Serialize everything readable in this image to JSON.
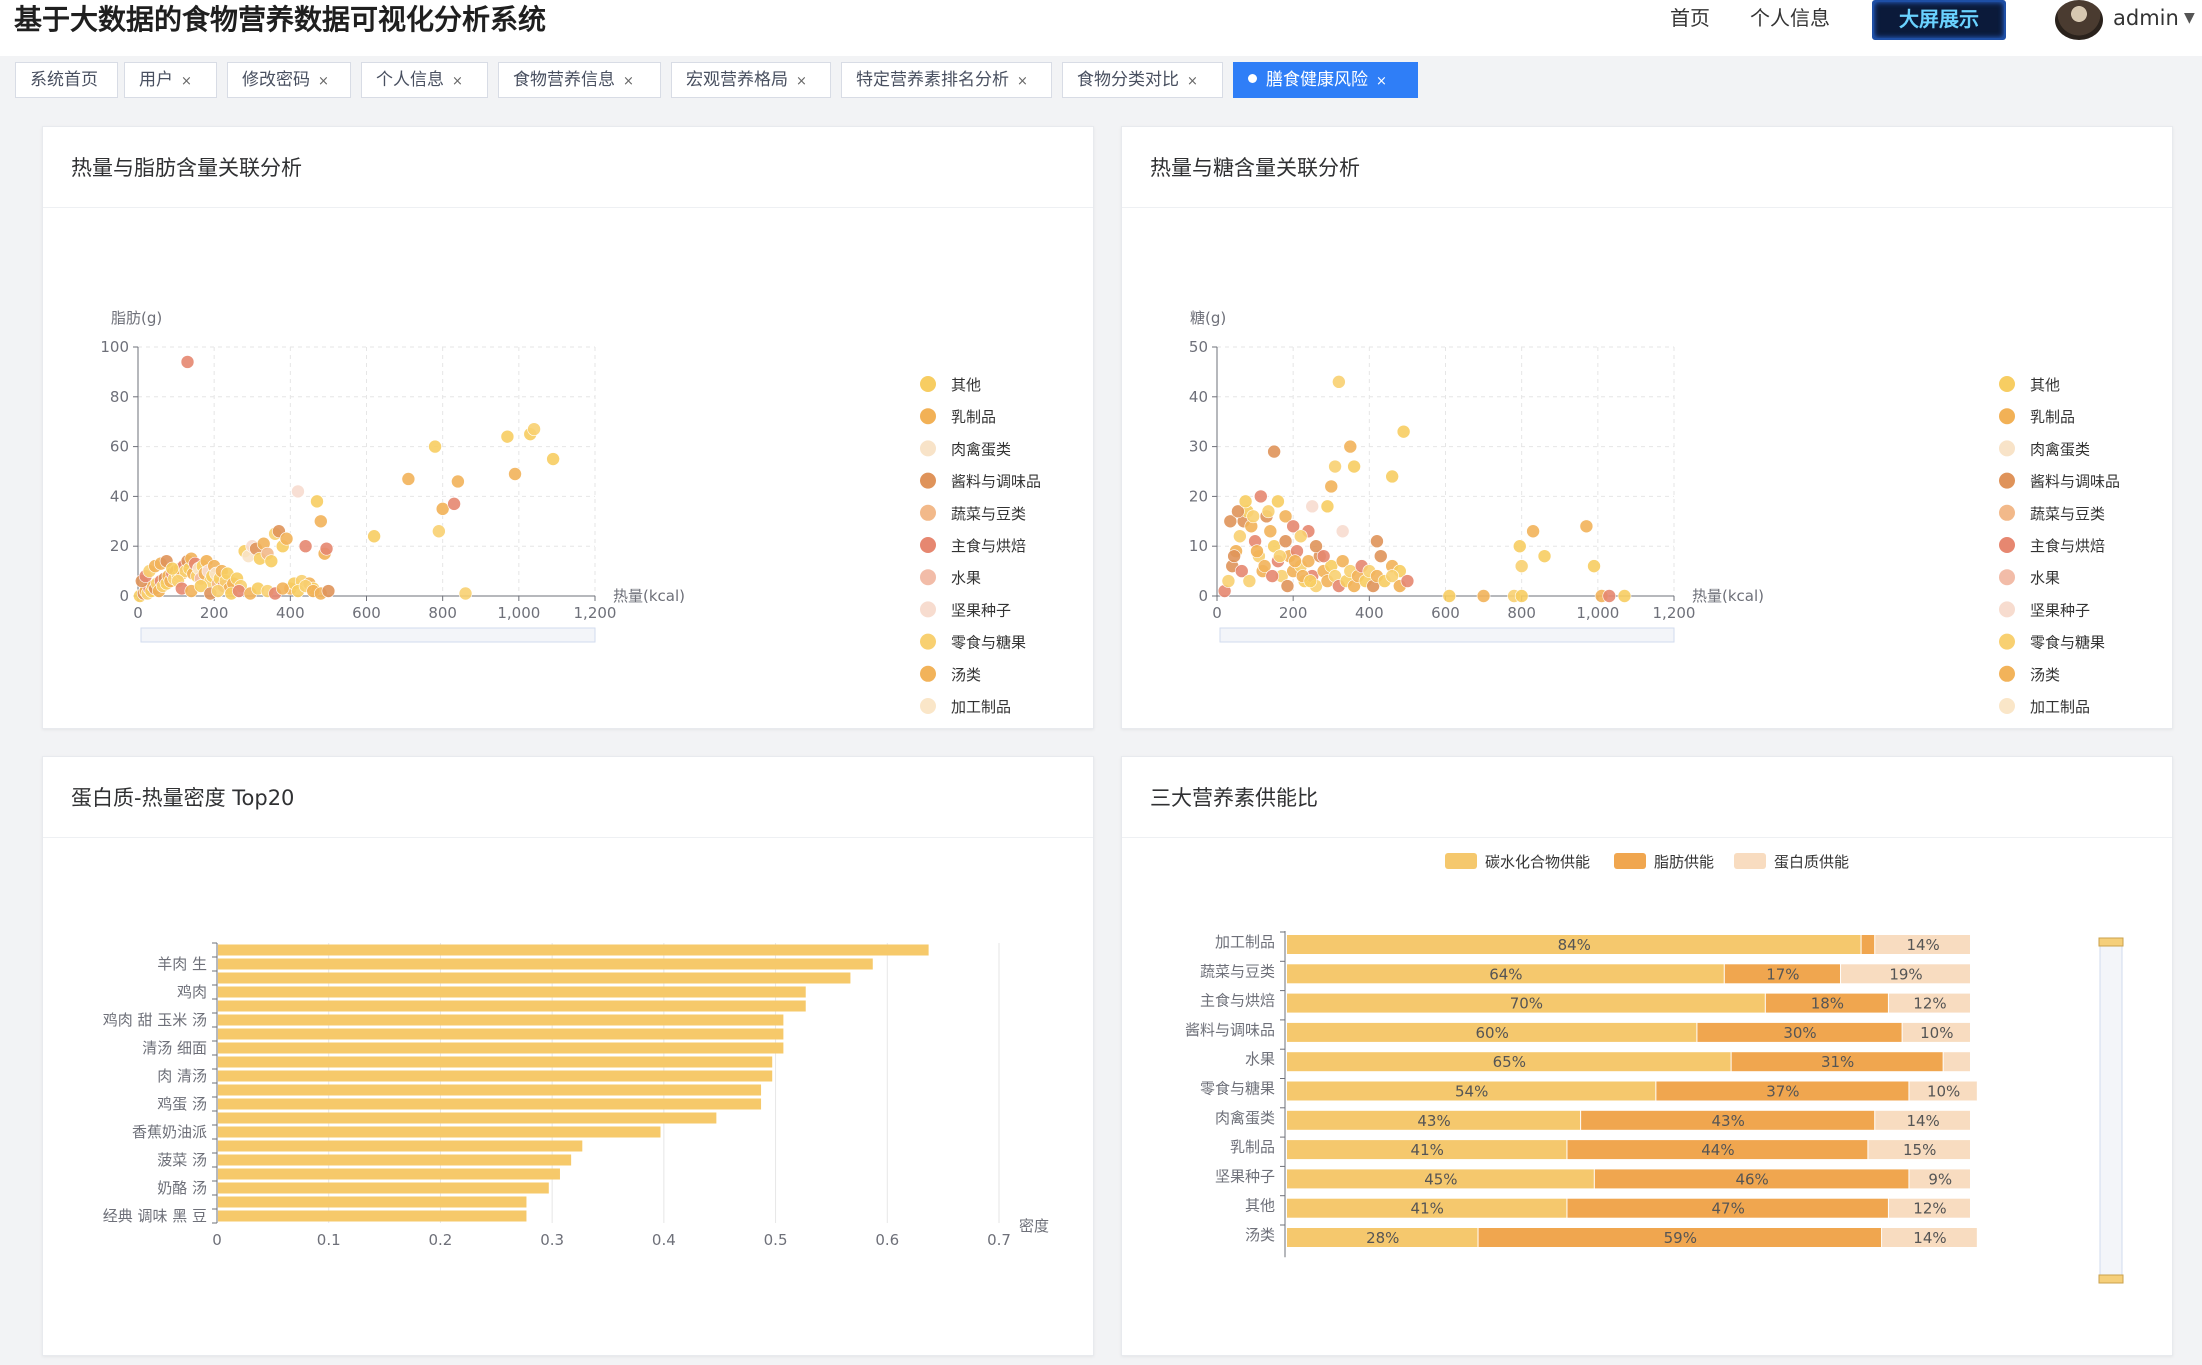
{
  "app": {
    "title": "基于大数据的食物营养数据可视化分析系统"
  },
  "nav": {
    "home": "首页",
    "profile": "个人信息",
    "big_screen": "大屏展示",
    "user": "admin"
  },
  "tabs": [
    {
      "label": "系统首页",
      "closable": false,
      "active": false
    },
    {
      "label": "用户",
      "closable": true,
      "active": false
    },
    {
      "label": "修改密码",
      "closable": true,
      "active": false
    },
    {
      "label": "个人信息",
      "closable": true,
      "active": false
    },
    {
      "label": "食物营养信息",
      "closable": true,
      "active": false
    },
    {
      "label": "宏观营养格局",
      "closable": true,
      "active": false
    },
    {
      "label": "特定营养素排名分析",
      "closable": true,
      "active": false
    },
    {
      "label": "食物分类对比",
      "closable": true,
      "active": false
    },
    {
      "label": "膳食健康风险",
      "closable": true,
      "active": true
    }
  ],
  "colors": {
    "accent": "#2f7ef7",
    "bar": "#f6c96a",
    "carb": "#f5c86d",
    "fat": "#f0a64f",
    "protein": "#f8dcc0"
  },
  "categories": [
    {
      "name": "其他",
      "color": "#f7cd62"
    },
    {
      "name": "乳制品",
      "color": "#f2b156"
    },
    {
      "name": "肉禽蛋类",
      "color": "#f8e3c8"
    },
    {
      "name": "酱料与调味品",
      "color": "#df935a"
    },
    {
      "name": "蔬菜与豆类",
      "color": "#f2b98a"
    },
    {
      "name": "主食与烘焙",
      "color": "#e68770"
    },
    {
      "name": "水果",
      "color": "#f2bca8"
    },
    {
      "name": "坚果种子",
      "color": "#f7dccf"
    },
    {
      "name": "零食与糖果",
      "color": "#f8d071"
    },
    {
      "name": "汤类",
      "color": "#f2b35a"
    },
    {
      "name": "加工制品",
      "color": "#fae6c8"
    }
  ],
  "panels": {
    "fat_scatter": {
      "title": "热量与脂肪含量关联分析"
    },
    "sugar_scatter": {
      "title": "热量与糖含量关联分析"
    },
    "protein_bar": {
      "title": "蛋白质-热量密度 Top20"
    },
    "macro_stack": {
      "title": "三大营养素供能比"
    }
  },
  "chart_data": [
    {
      "id": "fat_scatter",
      "type": "scatter",
      "xlabel": "热量(kcal)",
      "ylabel": "脂肪(g)",
      "xlim": [
        0,
        1200
      ],
      "ylim": [
        0,
        100
      ],
      "xticks": [
        0,
        200,
        400,
        600,
        800,
        1000,
        1200
      ],
      "xtick_labels": [
        "0",
        "200",
        "400",
        "600",
        "800",
        "1,000",
        "1,200"
      ],
      "yticks": [
        0,
        20,
        40,
        60,
        80,
        100
      ],
      "grid": true,
      "legend_position": "right",
      "points": [
        [
          130,
          94,
          5
        ],
        [
          5,
          0,
          0
        ],
        [
          15,
          1,
          3
        ],
        [
          20,
          2,
          1
        ],
        [
          25,
          1,
          8
        ],
        [
          30,
          3,
          5
        ],
        [
          35,
          2,
          0
        ],
        [
          40,
          4,
          9
        ],
        [
          45,
          3,
          3
        ],
        [
          50,
          5,
          8
        ],
        [
          55,
          2,
          1
        ],
        [
          60,
          6,
          5
        ],
        [
          65,
          4,
          8
        ],
        [
          70,
          7,
          3
        ],
        [
          75,
          5,
          0
        ],
        [
          80,
          8,
          9
        ],
        [
          85,
          6,
          1
        ],
        [
          90,
          9,
          5
        ],
        [
          95,
          7,
          8
        ],
        [
          100,
          10,
          3
        ],
        [
          105,
          8,
          0
        ],
        [
          110,
          11,
          9
        ],
        [
          115,
          9,
          1
        ],
        [
          120,
          12,
          5
        ],
        [
          125,
          10,
          8
        ],
        [
          130,
          14,
          3
        ],
        [
          135,
          11,
          0
        ],
        [
          140,
          15,
          9
        ],
        [
          145,
          9,
          1
        ],
        [
          150,
          13,
          5
        ],
        [
          155,
          8,
          8
        ],
        [
          160,
          11,
          10
        ],
        [
          165,
          7,
          6
        ],
        [
          170,
          12,
          0
        ],
        [
          175,
          9,
          9
        ],
        [
          180,
          14,
          1
        ],
        [
          185,
          10,
          7
        ],
        [
          190,
          6,
          8
        ],
        [
          195,
          8,
          0
        ],
        [
          200,
          12,
          9
        ],
        [
          205,
          9,
          2
        ],
        [
          210,
          5,
          4
        ],
        [
          215,
          7,
          0
        ],
        [
          220,
          10,
          9
        ],
        [
          225,
          4,
          5
        ],
        [
          230,
          6,
          8
        ],
        [
          235,
          9,
          0
        ],
        [
          240,
          3,
          1
        ],
        [
          250,
          5,
          9
        ],
        [
          260,
          7,
          0
        ],
        [
          270,
          4,
          8
        ],
        [
          280,
          18,
          0
        ],
        [
          290,
          16,
          2
        ],
        [
          300,
          20,
          7
        ],
        [
          310,
          19,
          3
        ],
        [
          320,
          15,
          0
        ],
        [
          330,
          21,
          9
        ],
        [
          340,
          17,
          4
        ],
        [
          350,
          14,
          0
        ],
        [
          360,
          25,
          8
        ],
        [
          370,
          26,
          3
        ],
        [
          380,
          20,
          0
        ],
        [
          390,
          23,
          9
        ],
        [
          400,
          3,
          1
        ],
        [
          410,
          5,
          0
        ],
        [
          420,
          42,
          7
        ],
        [
          430,
          6,
          8
        ],
        [
          440,
          20,
          5
        ],
        [
          450,
          5,
          9
        ],
        [
          460,
          3,
          0
        ],
        [
          470,
          38,
          0
        ],
        [
          480,
          30,
          9
        ],
        [
          490,
          17,
          1
        ],
        [
          495,
          19,
          5
        ],
        [
          620,
          24,
          0
        ],
        [
          710,
          47,
          9
        ],
        [
          780,
          60,
          0
        ],
        [
          790,
          26,
          8
        ],
        [
          800,
          35,
          1
        ],
        [
          830,
          37,
          5
        ],
        [
          840,
          46,
          9
        ],
        [
          860,
          1,
          8
        ],
        [
          970,
          64,
          0
        ],
        [
          990,
          49,
          9
        ],
        [
          1030,
          65,
          0
        ],
        [
          1040,
          67,
          8
        ],
        [
          1090,
          55,
          0
        ],
        [
          10,
          6,
          3
        ],
        [
          20,
          8,
          5
        ],
        [
          30,
          10,
          8
        ],
        [
          45,
          12,
          1
        ],
        [
          60,
          13,
          9
        ],
        [
          75,
          14,
          3
        ],
        [
          90,
          11,
          0
        ],
        [
          105,
          6,
          8
        ],
        [
          115,
          3,
          5
        ],
        [
          140,
          2,
          9
        ],
        [
          165,
          4,
          0
        ],
        [
          190,
          1,
          3
        ],
        [
          210,
          2,
          8
        ],
        [
          245,
          1,
          0
        ],
        [
          265,
          2,
          5
        ],
        [
          295,
          1,
          9
        ],
        [
          315,
          3,
          0
        ],
        [
          340,
          2,
          8
        ],
        [
          360,
          1,
          5
        ],
        [
          380,
          3,
          9
        ],
        [
          420,
          2,
          0
        ],
        [
          440,
          4,
          8
        ],
        [
          460,
          2,
          1
        ],
        [
          480,
          1,
          9
        ],
        [
          500,
          2,
          3
        ]
      ]
    },
    {
      "id": "sugar_scatter",
      "type": "scatter",
      "xlabel": "热量(kcal)",
      "ylabel": "糖(g)",
      "xlim": [
        0,
        1200
      ],
      "ylim": [
        0,
        50
      ],
      "xticks": [
        0,
        200,
        400,
        600,
        800,
        1000,
        1200
      ],
      "xtick_labels": [
        "0",
        "200",
        "400",
        "600",
        "800",
        "1,000",
        "1,200"
      ],
      "yticks": [
        0,
        10,
        20,
        30,
        40,
        50
      ],
      "grid": true,
      "legend_position": "right",
      "points": [
        [
          150,
          29,
          3
        ],
        [
          320,
          43,
          8
        ],
        [
          490,
          33,
          0
        ],
        [
          350,
          30,
          9
        ],
        [
          310,
          26,
          8
        ],
        [
          360,
          26,
          0
        ],
        [
          300,
          22,
          9
        ],
        [
          460,
          24,
          0
        ],
        [
          250,
          18,
          7
        ],
        [
          240,
          13,
          5
        ],
        [
          290,
          18,
          0
        ],
        [
          330,
          13,
          7
        ],
        [
          420,
          11,
          3
        ],
        [
          460,
          6,
          9
        ],
        [
          430,
          8,
          3
        ],
        [
          480,
          5,
          0
        ],
        [
          20,
          1,
          5
        ],
        [
          30,
          3,
          8
        ],
        [
          40,
          6,
          3
        ],
        [
          50,
          9,
          1
        ],
        [
          60,
          12,
          8
        ],
        [
          70,
          15,
          3
        ],
        [
          80,
          17,
          0
        ],
        [
          90,
          14,
          9
        ],
        [
          100,
          11,
          5
        ],
        [
          110,
          8,
          8
        ],
        [
          120,
          5,
          1
        ],
        [
          130,
          16,
          3
        ],
        [
          140,
          13,
          9
        ],
        [
          150,
          10,
          0
        ],
        [
          160,
          7,
          5
        ],
        [
          170,
          4,
          8
        ],
        [
          180,
          11,
          3
        ],
        [
          190,
          8,
          9
        ],
        [
          200,
          5,
          1
        ],
        [
          210,
          9,
          5
        ],
        [
          220,
          6,
          8
        ],
        [
          230,
          3,
          0
        ],
        [
          240,
          7,
          9
        ],
        [
          250,
          4,
          5
        ],
        [
          260,
          2,
          8
        ],
        [
          270,
          8,
          3
        ],
        [
          280,
          5,
          1
        ],
        [
          290,
          3,
          9
        ],
        [
          300,
          6,
          0
        ],
        [
          310,
          4,
          8
        ],
        [
          320,
          2,
          5
        ],
        [
          330,
          7,
          9
        ],
        [
          340,
          3,
          0
        ],
        [
          350,
          5,
          8
        ],
        [
          360,
          2,
          1
        ],
        [
          370,
          4,
          9
        ],
        [
          380,
          6,
          5
        ],
        [
          390,
          3,
          0
        ],
        [
          400,
          5,
          8
        ],
        [
          410,
          2,
          3
        ],
        [
          420,
          4,
          9
        ],
        [
          440,
          3,
          0
        ],
        [
          460,
          4,
          8
        ],
        [
          480,
          2,
          1
        ],
        [
          500,
          3,
          5
        ],
        [
          35,
          15,
          3
        ],
        [
          55,
          17,
          3
        ],
        [
          75,
          19,
          0
        ],
        [
          95,
          16,
          8
        ],
        [
          115,
          20,
          5
        ],
        [
          135,
          17,
          8
        ],
        [
          160,
          19,
          0
        ],
        [
          180,
          16,
          9
        ],
        [
          200,
          14,
          5
        ],
        [
          220,
          12,
          8
        ],
        [
          260,
          10,
          3
        ],
        [
          280,
          8,
          5
        ],
        [
          610,
          0,
          0
        ],
        [
          700,
          0,
          9
        ],
        [
          780,
          0,
          8
        ],
        [
          800,
          0,
          0
        ],
        [
          1010,
          0,
          9
        ],
        [
          1030,
          0,
          5
        ],
        [
          1070,
          0,
          0
        ],
        [
          795,
          10,
          0
        ],
        [
          800,
          6,
          8
        ],
        [
          830,
          13,
          9
        ],
        [
          860,
          8,
          0
        ],
        [
          970,
          14,
          9
        ],
        [
          990,
          6,
          0
        ],
        [
          45,
          8,
          3
        ],
        [
          65,
          5,
          5
        ],
        [
          85,
          3,
          8
        ],
        [
          105,
          9,
          1
        ],
        [
          125,
          6,
          9
        ],
        [
          145,
          4,
          5
        ],
        [
          165,
          8,
          8
        ],
        [
          185,
          2,
          3
        ],
        [
          205,
          7,
          1
        ],
        [
          225,
          4,
          9
        ],
        [
          245,
          3,
          0
        ]
      ]
    },
    {
      "id": "protein_bar",
      "type": "bar",
      "orientation": "horizontal",
      "xlabel": "密度",
      "xlim": [
        0,
        0.7
      ],
      "xticks": [
        0,
        0.1,
        0.2,
        0.3,
        0.4,
        0.5,
        0.6,
        0.7
      ],
      "categories": [
        "经典 调味 黑 豆",
        "",
        "奶酪 汤",
        "",
        "菠菜 汤",
        "",
        "香蕉奶油派",
        "",
        "鸡蛋 汤",
        "",
        "肉 清汤",
        "",
        "清汤 细面",
        "",
        "鸡肉 甜 玉米 汤",
        "",
        "鸡肉",
        "",
        "羊肉 生",
        ""
      ],
      "values": [
        0.277,
        0.277,
        0.297,
        0.307,
        0.317,
        0.327,
        0.397,
        0.447,
        0.487,
        0.487,
        0.497,
        0.497,
        0.507,
        0.507,
        0.507,
        0.527,
        0.527,
        0.567,
        0.587,
        0.637
      ]
    },
    {
      "id": "macro_stack",
      "type": "bar",
      "orientation": "horizontal",
      "stacked": true,
      "percent": true,
      "legend_position": "top",
      "categories": [
        "加工制品",
        "蔬菜与豆类",
        "主食与烘焙",
        "酱料与调味品",
        "水果",
        "零食与糖果",
        "肉禽蛋类",
        "乳制品",
        "坚果种子",
        "其他",
        "汤类"
      ],
      "series": [
        {
          "name": "碳水化合物供能",
          "values": [
            84,
            64,
            70,
            60,
            65,
            54,
            43,
            41,
            45,
            41,
            28
          ],
          "labels": [
            "84%",
            "64%",
            "70%",
            "60%",
            "65%",
            "54%",
            "43%",
            "41%",
            "45%",
            "41%",
            "28%"
          ]
        },
        {
          "name": "脂肪供能",
          "values": [
            2,
            17,
            18,
            30,
            31,
            37,
            43,
            44,
            46,
            47,
            59
          ],
          "labels": [
            "",
            "17%",
            "18%",
            "30%",
            "31%",
            "37%",
            "43%",
            "44%",
            "46%",
            "47%",
            "59%"
          ]
        },
        {
          "name": "蛋白质供能",
          "values": [
            14,
            19,
            12,
            10,
            4,
            10,
            14,
            15,
            9,
            12,
            14
          ],
          "labels": [
            "14%",
            "19%",
            "12%",
            "10%",
            "",
            "10%",
            "14%",
            "15%",
            "9%",
            "12%",
            "14%"
          ]
        }
      ]
    }
  ]
}
